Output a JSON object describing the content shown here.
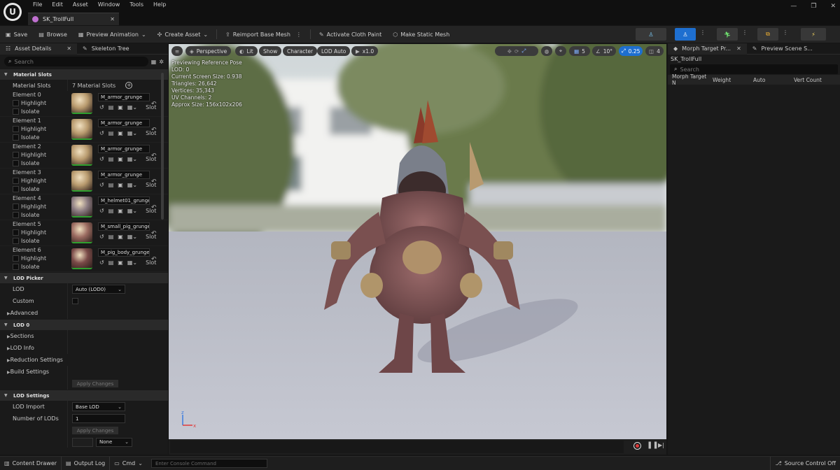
{
  "menu": [
    "File",
    "Edit",
    "Asset",
    "Window",
    "Tools",
    "Help"
  ],
  "doc_tab": "SK_TrollFull",
  "toolbar": {
    "save": "Save",
    "browse": "Browse",
    "preview_animation": "Preview Animation",
    "create_asset": "Create Asset",
    "reimport": "Reimport Base Mesh",
    "activate_cloth": "Activate Cloth Paint",
    "make_static": "Make Static Mesh"
  },
  "left_tabs": [
    "Asset Details",
    "Skeleton Tree"
  ],
  "search_placeholder": "Search",
  "material_slots": {
    "header": "Material Slots",
    "label": "Material Slots",
    "count": "7 Material Slots",
    "highlight": "Highlight",
    "isolate": "Isolate",
    "slot": "Slot",
    "elements": [
      {
        "name": "Element 0",
        "material": "M_armor_grunge",
        "color": "#b89a6e"
      },
      {
        "name": "Element 1",
        "material": "M_armor_grunge",
        "color": "#b89a6e"
      },
      {
        "name": "Element 2",
        "material": "M_armor_grunge",
        "color": "#b89a6e"
      },
      {
        "name": "Element 3",
        "material": "M_armor_grunge",
        "color": "#b89a6e"
      },
      {
        "name": "Element 4",
        "material": "M_helmet01_grunge",
        "color": "#8a7a80"
      },
      {
        "name": "Element 5",
        "material": "M_small_pig_grunge",
        "color": "#9a6a60"
      },
      {
        "name": "Element 6",
        "material": "M_pig_body_grunge",
        "color": "#7a4a48"
      }
    ]
  },
  "lod_picker": {
    "header": "LOD Picker",
    "lod_label": "LOD",
    "lod_value": "Auto (LOD0)",
    "custom_label": "Custom",
    "advanced": "Advanced"
  },
  "lod0": {
    "header": "LOD 0",
    "items": [
      "Sections",
      "LOD Info",
      "Reduction Settings",
      "Build Settings"
    ],
    "apply": "Apply Changes"
  },
  "lod_settings": {
    "header": "LOD Settings",
    "import_label": "LOD Import",
    "import_value": "Base LOD",
    "num_label": "Number of LODs",
    "num_value": "1",
    "apply": "Apply Changes",
    "none_value": "None"
  },
  "viewport": {
    "perspective": "Perspective",
    "lit": "Lit",
    "show": "Show",
    "character": "Character",
    "lod_auto": "LOD Auto",
    "speed": "x1.0",
    "grid_value": "5",
    "angle_value": "10°",
    "scale_value": "0.25",
    "camera_value": "4",
    "stats": [
      "Previewing Reference Pose",
      "LOD: 0",
      "Current Screen Size: 0.938",
      "Triangles: 26,642",
      "Vertices: 35,343",
      "UV Channels: 2",
      "Approx Size: 156x102x206"
    ]
  },
  "right_tabs": [
    "Morph Target Pr...",
    "Preview Scene S..."
  ],
  "right_asset": "SK_TrollFull",
  "morph_columns": [
    "Morph Target N",
    "Weight",
    "Auto",
    "Vert Count"
  ],
  "status": {
    "content_drawer": "Content Drawer",
    "output_log": "Output Log",
    "cmd": "Cmd",
    "console_placeholder": "Enter Console Command",
    "source_control": "Source Control Off"
  }
}
